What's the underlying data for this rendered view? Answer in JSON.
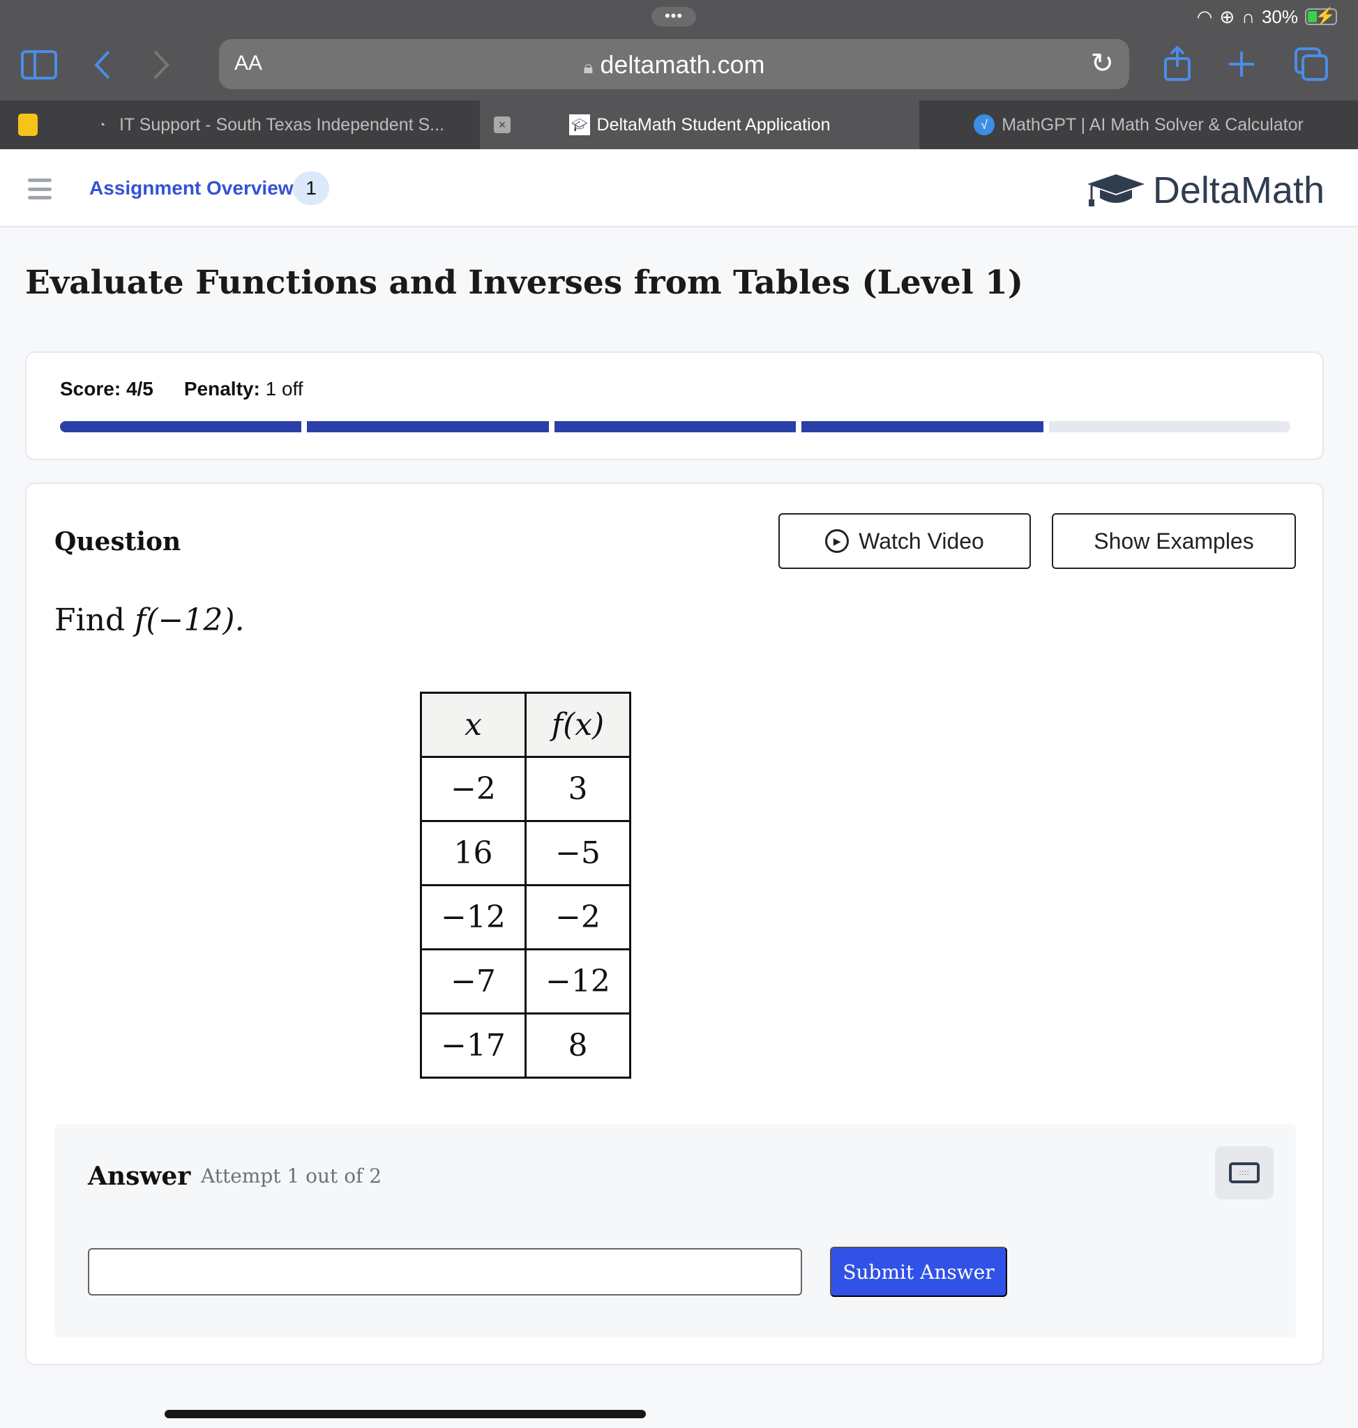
{
  "status_bar": {
    "battery": "30%",
    "icons": [
      "wifi-icon",
      "orientation-lock-icon",
      "headphones-icon",
      "battery-charging-icon"
    ]
  },
  "browser": {
    "text_size_label": "AA",
    "url": "deltamath.com",
    "tabs": [
      {
        "title": "IT Support - South Texas Independent S...",
        "active": false
      },
      {
        "title": "DeltaMath Student Application",
        "active": true
      },
      {
        "title": "MathGPT | AI Math Solver & Calculator",
        "active": false
      }
    ]
  },
  "app": {
    "breadcrumb": "Assignment Overview",
    "badge": "1",
    "logo_text": "DeltaMath",
    "accent": "#3352d6"
  },
  "page": {
    "title": "Evaluate Functions and Inverses from Tables (Level 1)"
  },
  "score": {
    "score_label": "Score:",
    "score_value": "4/5",
    "penalty_label": "Penalty:",
    "penalty_value": "1 off",
    "segments_total": 5,
    "segments_complete": 4
  },
  "question": {
    "label": "Question",
    "watch_video": "Watch Video",
    "show_examples": "Show Examples",
    "prompt_prefix": "Find ",
    "prompt_math": "f(−12).",
    "table": {
      "headers": [
        "x",
        "f(x)"
      ],
      "rows": [
        [
          "−2",
          "3"
        ],
        [
          "16",
          "−5"
        ],
        [
          "−12",
          "−2"
        ],
        [
          "−7",
          "−12"
        ],
        [
          "−17",
          "8"
        ]
      ]
    }
  },
  "answer": {
    "label": "Answer",
    "attempt": "Attempt 1 out of 2",
    "input_value": "",
    "submit": "Submit Answer"
  }
}
